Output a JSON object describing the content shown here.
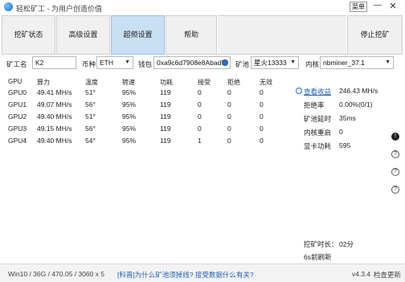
{
  "app": {
    "title": "轻松矿工 - 为用户创造价值",
    "menu_label": "菜单",
    "minimize": "—",
    "close": "✕"
  },
  "toolbar": {
    "status": "挖矿状态",
    "advanced": "高级设置",
    "super": "超频设置",
    "help": "帮助",
    "stop": "停止挖矿"
  },
  "settings": {
    "miner_name_label": "矿工名",
    "miner_name_value": "K2",
    "coin_label": "币种",
    "coin_value": "ETH",
    "wallet_label": "钱包",
    "wallet_value": "0xa9c6d7908e8Abad7",
    "pool_label": "矿池",
    "pool_value": "星火13333",
    "kernel_label": "内核",
    "kernel_value": "nbminer_37.1"
  },
  "table": {
    "headers": [
      "GPU",
      "算力",
      "温度",
      "转速",
      "功耗",
      "接受",
      "拒绝",
      "无效"
    ],
    "rows": [
      [
        "GPU0",
        "49.41 MH/s",
        "51°",
        "95%",
        "119",
        "0",
        "0",
        "0"
      ],
      [
        "GPU1",
        "49.07 MH/s",
        "56°",
        "95%",
        "119",
        "0",
        "0",
        "0"
      ],
      [
        "GPU2",
        "49.40 MH/s",
        "51°",
        "95%",
        "119",
        "0",
        "0",
        "0"
      ],
      [
        "GPU3",
        "49.15 MH/s",
        "56°",
        "95%",
        "119",
        "0",
        "0",
        "0"
      ],
      [
        "GPU4",
        "49.40 MH/s",
        "54°",
        "95%",
        "119",
        "1",
        "0",
        "0"
      ]
    ]
  },
  "summary": {
    "profit_link": "查看收益",
    "hashrate": "246.43 MH/s",
    "reject_label": "拒绝率",
    "reject_value": "0.00%(0/1)",
    "latency_label": "矿池延时",
    "latency_value": "35ms",
    "restart_label": "内核重启",
    "restart_value": "0",
    "power_label": "显卡功耗",
    "power_value": "595",
    "duration_label": "挖矿时长：",
    "duration_value": "02分",
    "refresh_text": "6s前刷新"
  },
  "side_icons": [
    "!",
    "?",
    "?",
    "?"
  ],
  "statusbar": {
    "system": "Win10  /  36G / 470.05 / 3060 x 5",
    "news": "[科普]为什么矿池须掉线?  接受数据什么有关?",
    "version": "v4.3.4",
    "check_update": "检查更新"
  }
}
